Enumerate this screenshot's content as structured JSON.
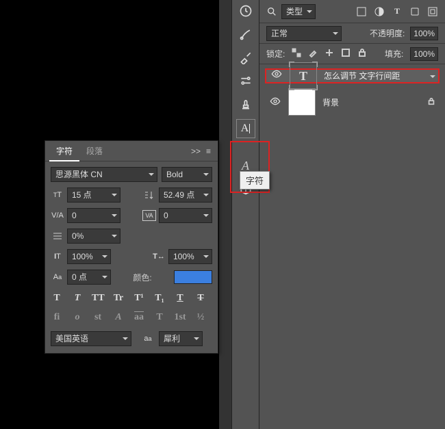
{
  "type_filter": {
    "label": "类型"
  },
  "blend": {
    "mode": "正常",
    "opacity_label": "不透明度:",
    "opacity_value": "100%"
  },
  "lock": {
    "label": "锁定:",
    "fill_label": "填充:",
    "fill_value": "100%"
  },
  "layers": [
    {
      "name": "怎么调节 文字行间距",
      "type": "text",
      "selected": true,
      "visible": true
    },
    {
      "name": "背景",
      "type": "bg",
      "selected": false,
      "visible": true,
      "locked": true
    }
  ],
  "char_panel": {
    "tabs": {
      "char": "字符",
      "para": "段落",
      "expand": ">>"
    },
    "font_family": "思源黑体 CN",
    "font_style": "Bold",
    "size": "15 点",
    "leading": "52.49 点",
    "va": "0",
    "tracking": "0",
    "baseline_pct": "0%",
    "hscale": "100%",
    "vscale": "100%",
    "baseline_shift": "0 点",
    "color_label": "颜色:",
    "language": "美国英语",
    "aa": "犀利",
    "color": "#3b7fe0",
    "formats": {
      "bold": "T",
      "italic": "T",
      "allcaps": "TT",
      "smallcaps": "Tr",
      "super": "T¹",
      "sub": "T₁",
      "under": "T",
      "strike": "T",
      "fi": "fi",
      "o": "o",
      "st": "st",
      "a": "A",
      "aa2": "aa",
      "t2": "T",
      "first": "1st",
      "half": "½"
    }
  },
  "tooltip": {
    "label": "字符"
  }
}
